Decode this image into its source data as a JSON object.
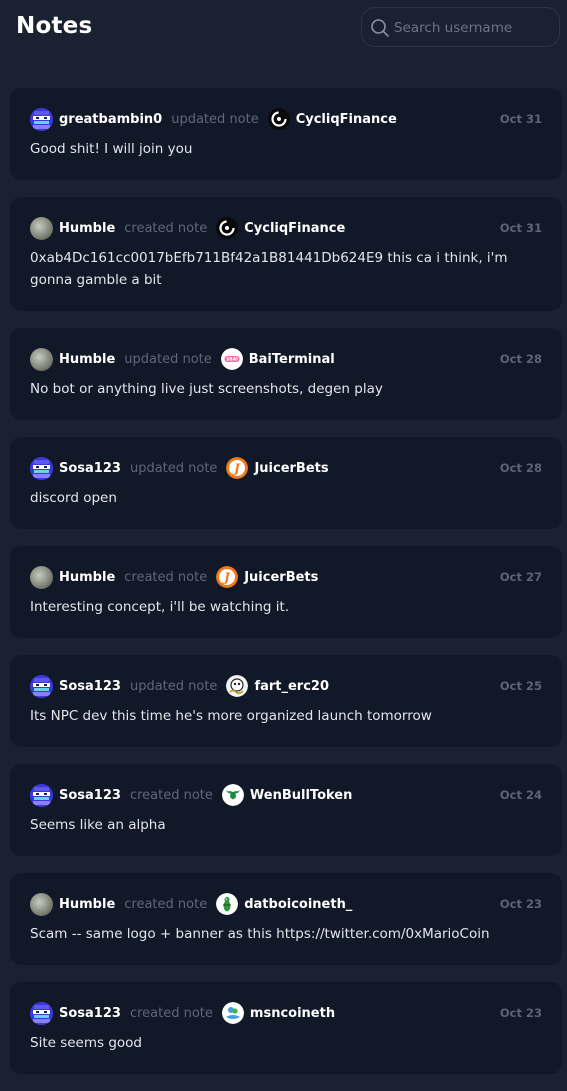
{
  "header": {
    "title": "Notes",
    "search_placeholder": "Search username"
  },
  "notes": [
    {
      "user": "greatbambin0",
      "avatar": "pixel-avatar",
      "action": "updated note",
      "project": "CycliqFinance",
      "project_icon": "cycliq-icon",
      "date": "Oct 31",
      "text": "Good shit! I will join you"
    },
    {
      "user": "Humble",
      "avatar": "gray-avatar",
      "action": "created note",
      "project": "CycliqFinance",
      "project_icon": "cycliq-icon",
      "date": "Oct 31",
      "text": "0xab4Dc161cc0017bEfb711Bf42a1B81441Db624E9 this ca i think, i'm gonna gamble a bit"
    },
    {
      "user": "Humble",
      "avatar": "gray-avatar",
      "action": "updated note",
      "project": "BaiTerminal",
      "project_icon": "bai-icon",
      "date": "Oct 28",
      "text": "No bot or anything live just screenshots, degen play"
    },
    {
      "user": "Sosa123",
      "avatar": "pixel-avatar",
      "action": "updated note",
      "project": "JuicerBets",
      "project_icon": "juicer-icon",
      "date": "Oct 28",
      "text": "discord open"
    },
    {
      "user": "Humble",
      "avatar": "gray-avatar",
      "action": "created note",
      "project": "JuicerBets",
      "project_icon": "juicer-icon",
      "date": "Oct 27",
      "text": "Interesting concept, i'll be watching it."
    },
    {
      "user": "Sosa123",
      "avatar": "pixel-avatar",
      "action": "updated note",
      "project": "fart_erc20",
      "project_icon": "fart-icon",
      "date": "Oct 25",
      "text": "Its NPC dev this time he's more organized launch tomorrow"
    },
    {
      "user": "Sosa123",
      "avatar": "pixel-avatar",
      "action": "created note",
      "project": "WenBullToken",
      "project_icon": "bull-icon",
      "date": "Oct 24",
      "text": "Seems like an alpha"
    },
    {
      "user": "Humble",
      "avatar": "gray-avatar",
      "action": "created note",
      "project": "datboicoineth_",
      "project_icon": "frog-icon",
      "date": "Oct 23",
      "text": "Scam -- same logo + banner as this https://twitter.com/0xMarioCoin"
    },
    {
      "user": "Sosa123",
      "avatar": "pixel-avatar",
      "action": "created note",
      "project": "msncoineth",
      "project_icon": "msn-icon",
      "date": "Oct 23",
      "text": "Site seems good"
    }
  ],
  "colors": {
    "background": "#1a2130",
    "card": "#111827",
    "muted": "#5f6878",
    "juicer_orange": "#f07a1a",
    "bull_green": "#1e8a3c"
  }
}
